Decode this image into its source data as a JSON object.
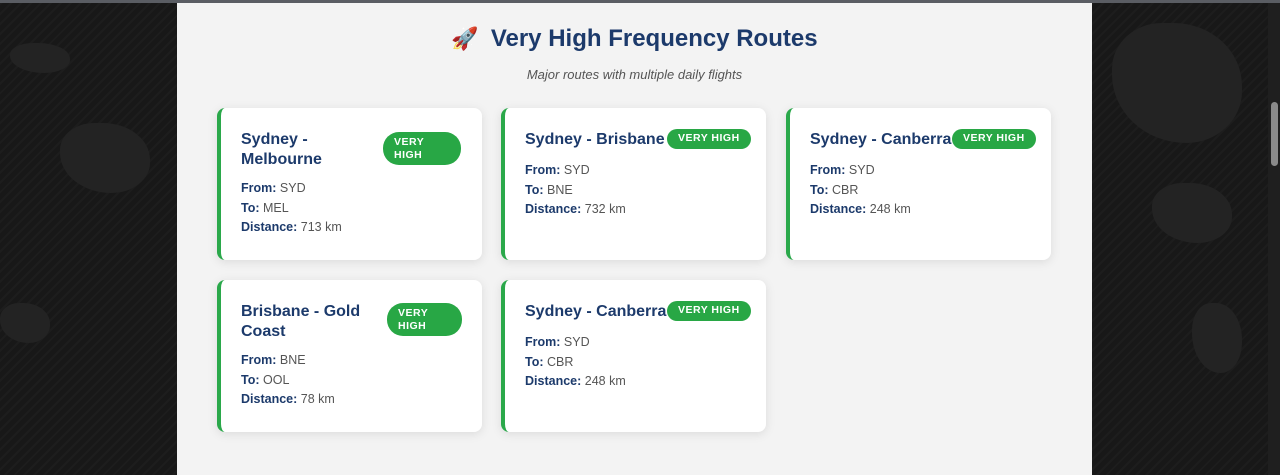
{
  "header": {
    "icon": "rocket-icon",
    "rocket_glyph": "🚀",
    "title": "Very High Frequency Routes",
    "subtitle": "Major routes with multiple daily flights"
  },
  "labels": {
    "from": "From:",
    "to": "To:",
    "distance": "Distance:"
  },
  "colors": {
    "accent_green": "#28a745",
    "title_navy": "#1c3a6b",
    "panel_bg": "#f3f3f3"
  },
  "routes": [
    {
      "title": "Sydney - Melbourne",
      "badge": "VERY HIGH",
      "from": "SYD",
      "to": "MEL",
      "distance": "713 km"
    },
    {
      "title": "Sydney - Brisbane",
      "badge": "VERY HIGH",
      "from": "SYD",
      "to": "BNE",
      "distance": "732 km"
    },
    {
      "title": "Sydney - Canberra",
      "badge": "VERY HIGH",
      "from": "SYD",
      "to": "CBR",
      "distance": "248 km"
    },
    {
      "title": "Brisbane - Gold Coast",
      "badge": "VERY HIGH",
      "from": "BNE",
      "to": "OOL",
      "distance": "78 km"
    },
    {
      "title": "Sydney - Canberra",
      "badge": "VERY HIGH",
      "from": "SYD",
      "to": "CBR",
      "distance": "248 km"
    }
  ]
}
